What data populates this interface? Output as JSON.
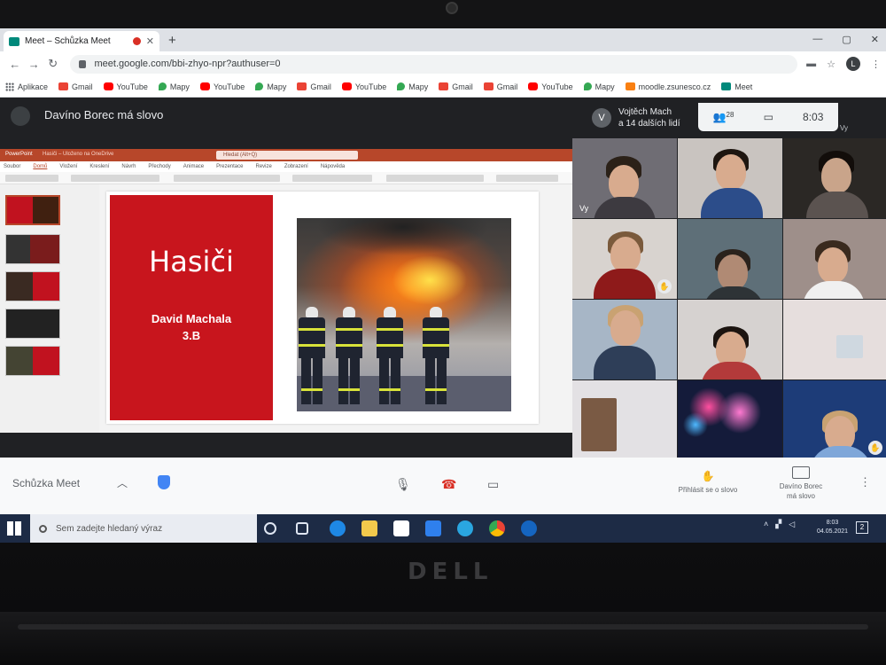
{
  "browser": {
    "tab_title": "Meet – Schůzka Meet",
    "tab_close": "✕",
    "new_tab": "+",
    "url": "meet.google.com/bbi-zhyo-npr?authuser=0",
    "profile_initial": "L",
    "window_controls": [
      "—",
      "▢",
      "✕"
    ]
  },
  "bookmarks": [
    {
      "label": "Aplikace",
      "icon": "apps-icon"
    },
    {
      "label": "Gmail",
      "icon": "gmail-icon"
    },
    {
      "label": "YouTube",
      "icon": "youtube-icon"
    },
    {
      "label": "Mapy",
      "icon": "maps-icon"
    },
    {
      "label": "YouTube",
      "icon": "youtube-icon"
    },
    {
      "label": "Mapy",
      "icon": "maps-icon"
    },
    {
      "label": "Gmail",
      "icon": "gmail-icon"
    },
    {
      "label": "YouTube",
      "icon": "youtube-icon"
    },
    {
      "label": "Mapy",
      "icon": "maps-icon"
    },
    {
      "label": "Gmail",
      "icon": "gmail-icon"
    },
    {
      "label": "Gmail",
      "icon": "gmail-icon"
    },
    {
      "label": "YouTube",
      "icon": "youtube-icon"
    },
    {
      "label": "Mapy",
      "icon": "maps-icon"
    },
    {
      "label": "moodle.zsunesco.cz",
      "icon": "moodle-icon"
    },
    {
      "label": "Meet",
      "icon": "meet-icon"
    }
  ],
  "meet": {
    "presenter_title": "Davíno Borec má slovo",
    "others_avatar": "V",
    "others_line1": "Vojtěch Mach",
    "others_line2": "a 14 dalších lidí",
    "participants_count": "28",
    "time": "8:03",
    "self_label": "Vy",
    "meeting_name": "Schůzka Meet",
    "raise_hand_label": "Přihlásit se o slovo",
    "presenting_line1": "Davíno Borec",
    "presenting_line2": "má slovo"
  },
  "powerpoint": {
    "app_name": "PowerPoint",
    "doc_name": "Hasiči – Uloženo na OneDrive",
    "search_placeholder": "Hledat (Alt+Q)",
    "ribbon_tabs": [
      "Soubor",
      "Domů",
      "Vložení",
      "Kreslení",
      "Návrh",
      "Přechody",
      "Animace",
      "Prezentace",
      "Revize",
      "Zobrazení",
      "Nápověda"
    ],
    "slide_title": "Hasiči",
    "slide_author": "David Machala",
    "slide_class": "3.B"
  },
  "taskbar": {
    "search_placeholder": "Sem zadejte hledaný výraz",
    "time": "8:03",
    "date": "04.05.2021",
    "notification_count": "2"
  },
  "device": {
    "brand": "DELL"
  },
  "colors": {
    "slide_red": "#c8151d",
    "powerpoint_accent": "#b7472a",
    "meet_dark": "#202124",
    "hangup_red": "#d93025"
  }
}
